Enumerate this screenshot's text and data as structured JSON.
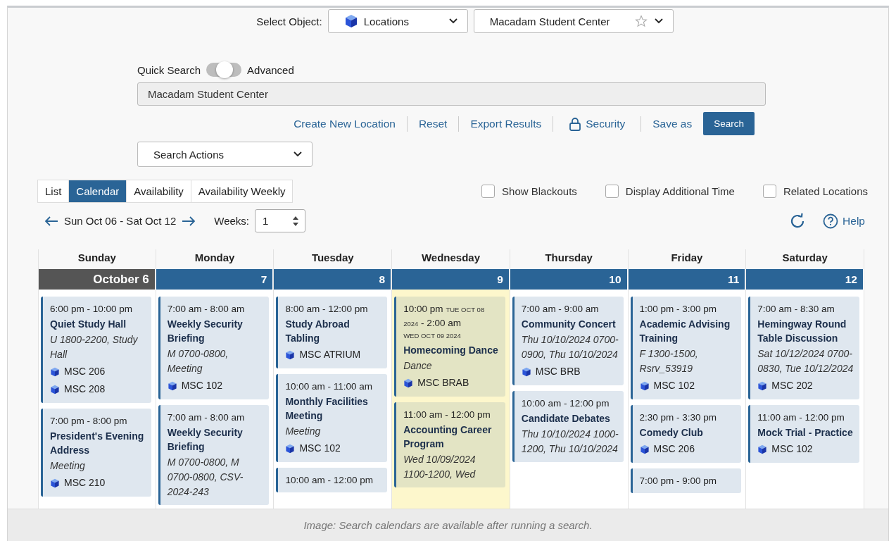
{
  "select_object": {
    "label": "Select Object:",
    "object_type": "Locations",
    "object_name": "Macadam Student Center",
    "favorite": false
  },
  "search_mode": {
    "left": "Quick Search",
    "right": "Advanced",
    "on": false
  },
  "search_field": {
    "value": "Macadam Student Center"
  },
  "actions": [
    {
      "label": "Create New Location",
      "kind": "link"
    },
    {
      "label": "Reset",
      "kind": "link"
    },
    {
      "label": "Export Results",
      "kind": "link"
    },
    {
      "label": "Security",
      "kind": "lock-link"
    },
    {
      "label": "Save as",
      "kind": "link"
    },
    {
      "label": "Search",
      "kind": "button"
    }
  ],
  "search_actions": {
    "label": "Search Actions"
  },
  "view_tabs": [
    {
      "label": "List",
      "selected": false
    },
    {
      "label": "Calendar",
      "selected": true
    },
    {
      "label": "Availability",
      "selected": false
    },
    {
      "label": "Availability Weekly",
      "selected": false
    }
  ],
  "options": [
    {
      "label": "Show Blackouts",
      "checked": false
    },
    {
      "label": "Display Additional Time",
      "checked": false
    },
    {
      "label": "Related Locations",
      "checked": false
    }
  ],
  "date_nav": {
    "range": "Sun Oct 06 - Sat Oct 12",
    "weeks_label": "Weeks:",
    "weeks": "1"
  },
  "help": "Help",
  "calendar": {
    "days": [
      {
        "name": "Sunday",
        "date": "October 6",
        "kind": "month-start",
        "today": false,
        "events": [
          {
            "time": "6:00 pm - 10:00 pm",
            "title": "Quiet Study Hall",
            "detail": "U 1800-2200, Study Hall",
            "locations": [
              "MSC 206",
              "MSC 208"
            ]
          },
          {
            "time": "7:00 pm - 8:00 pm",
            "title": "President's Evening Address",
            "detail": "Meeting",
            "locations": [
              "MSC 210"
            ]
          }
        ]
      },
      {
        "name": "Monday",
        "date": "7",
        "kind": "day",
        "today": false,
        "events": [
          {
            "time": "7:00 am - 8:00 am",
            "title": "Weekly Security Briefing",
            "detail": "M 0700-0800, Meeting",
            "locations": [
              "MSC 102"
            ]
          },
          {
            "time": "7:00 am - 8:00 am",
            "title": "Weekly Security Briefing",
            "detail": "M 0700-0800, M 0700-0800, CSV-2024-243"
          }
        ]
      },
      {
        "name": "Tuesday",
        "date": "8",
        "kind": "day",
        "today": false,
        "events": [
          {
            "time": "8:00 am - 12:00 pm",
            "title": "Study Abroad Tabling",
            "locations": [
              "MSC ATRIUM"
            ]
          },
          {
            "time": "10:00 am - 11:00 am",
            "title": "Monthly Facilities Meeting",
            "detail": "Meeting",
            "locations": [
              "MSC 102"
            ]
          },
          {
            "time": "10:00 am - 12:00 pm"
          }
        ]
      },
      {
        "name": "Wednesday",
        "date": "9",
        "kind": "day",
        "today": true,
        "events": [
          {
            "time": "10:00 pm",
            "start_date": "TUE OCT 08 2024",
            "time_end": "- 2:00 am",
            "end_date": "WED OCT 09 2024",
            "title": "Homecoming Dance",
            "detail": "Dance",
            "locations": [
              "MSC BRAB"
            ]
          },
          {
            "time": "11:00 am - 12:00 pm",
            "title": "Accounting Career Program",
            "detail": "Wed 10/09/2024 1100-1200, Wed"
          }
        ]
      },
      {
        "name": "Thursday",
        "date": "10",
        "kind": "day",
        "today": false,
        "events": [
          {
            "time": "7:00 am - 9:00 am",
            "title": "Community Concert",
            "detail": "Thu 10/10/2024 0700-0900, Thu 10/10/2024",
            "locations": [
              "MSC BRB"
            ]
          },
          {
            "time": "10:00 am - 12:00 pm",
            "title": "Candidate Debates",
            "detail": "Thu 10/10/2024 1000-1200, Thu 10/10/2024"
          }
        ]
      },
      {
        "name": "Friday",
        "date": "11",
        "kind": "day",
        "today": false,
        "events": [
          {
            "time": "1:00 pm - 3:00 pm",
            "title": "Academic Advising Training",
            "detail": "F 1300-1500, Rsrv_53919",
            "locations": [
              "MSC 102"
            ]
          },
          {
            "time": "2:30 pm - 3:30 pm",
            "title": "Comedy Club",
            "locations": [
              "MSC 206"
            ]
          },
          {
            "time": "7:00 pm - 9:00 pm"
          }
        ]
      },
      {
        "name": "Saturday",
        "date": "12",
        "kind": "day",
        "today": false,
        "events": [
          {
            "time": "7:00 am - 8:30 am",
            "title": "Hemingway Round Table Discussion",
            "detail": "Sat 10/12/2024 0700-0830, Tue 10/12/2024",
            "locations": [
              "MSC 202"
            ]
          },
          {
            "time": "11:00 am - 12:00 pm",
            "title": "Mock Trial - Practice",
            "locations": [
              "MSC 102"
            ]
          }
        ]
      }
    ]
  },
  "caption": "Image: Search calendars are available after running a search."
}
